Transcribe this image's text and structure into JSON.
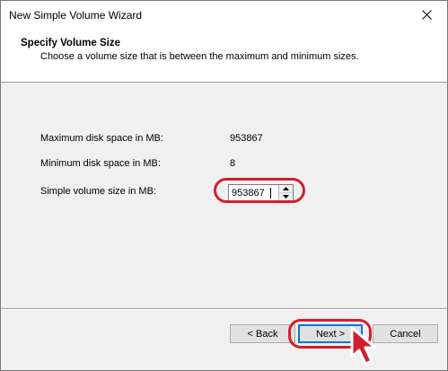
{
  "window": {
    "title": "New Simple Volume Wizard"
  },
  "header": {
    "title": "Specify Volume Size",
    "subtitle": "Choose a volume size that is between the maximum and minimum sizes."
  },
  "fields": {
    "max_label": "Maximum disk space in MB:",
    "max_value": "953867",
    "min_label": "Minimum disk space in MB:",
    "min_value": "8",
    "size_label": "Simple volume size in MB:",
    "size_value": "953867"
  },
  "buttons": {
    "back": "< Back",
    "next": "Next >",
    "cancel": "Cancel"
  },
  "icons": {
    "close": "close-icon",
    "spin_up": "arrow-up-icon",
    "spin_down": "arrow-down-icon",
    "cursor": "mouse-pointer-icon"
  },
  "colors": {
    "highlight": "#d21f2f",
    "focus_border": "#0078d7",
    "window_bg": "#f0f0f0"
  }
}
